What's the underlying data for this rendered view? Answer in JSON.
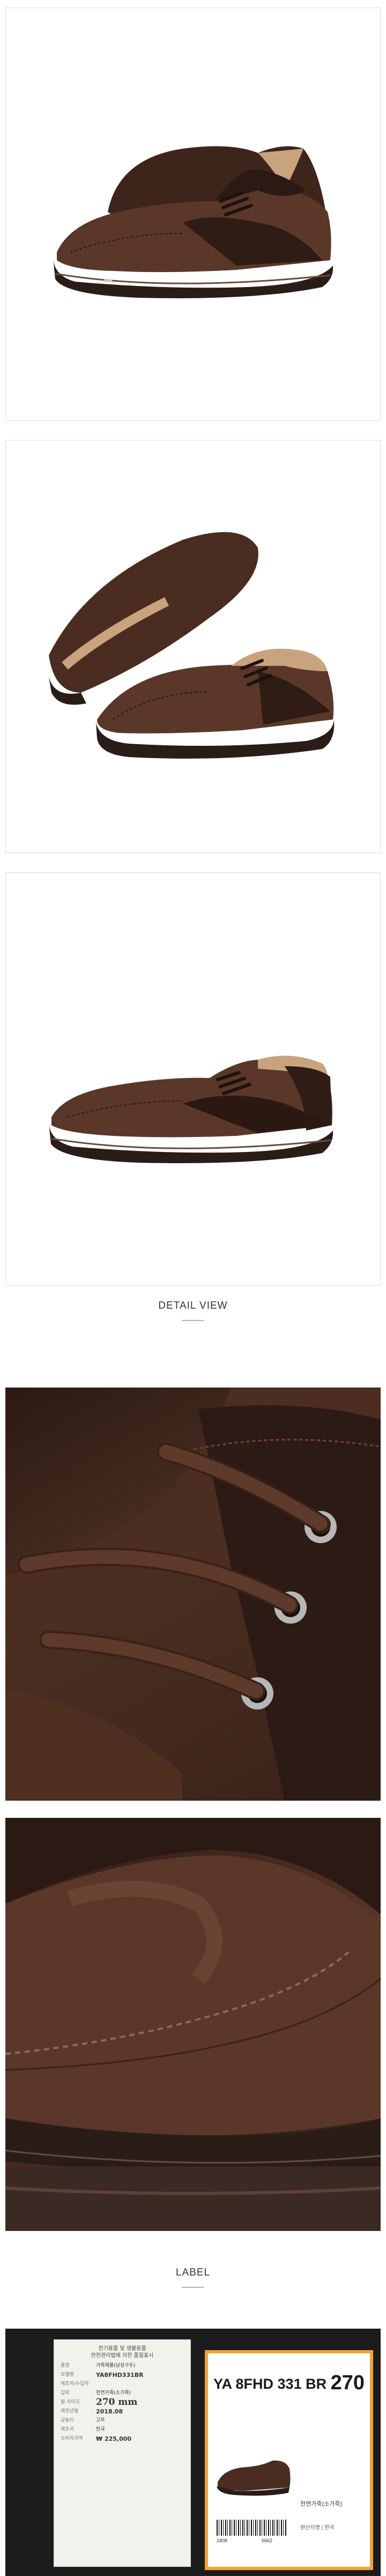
{
  "sections": {
    "detail_title": "DETAIL VIEW",
    "label_title": "LABEL"
  },
  "care_tag": {
    "header_line1": "전기용품 및 생활용품",
    "header_line2": "안전관리법에 의한 품질표시",
    "rows": [
      {
        "key": "품명",
        "value": "가죽제품(남성구두)"
      },
      {
        "key": "모델명",
        "value": "YA8FHD331BR"
      },
      {
        "key": "제조자/수입자",
        "value": ""
      },
      {
        "key": "갑피",
        "value": "천연가죽(소가죽)"
      },
      {
        "key": "발 사이즈",
        "value": "270 mm"
      },
      {
        "key": "제조년월",
        "value": "2018.08"
      },
      {
        "key": "굽높이",
        "value": "고무"
      },
      {
        "key": "제조국",
        "value": "한국"
      },
      {
        "key": "소비자가격",
        "value": "₩ 225,000"
      }
    ]
  },
  "size_label": {
    "code": "YA 8FHD 331 BR",
    "size": "270",
    "material": "천연가죽(소가죽)",
    "origin": "원산지명 | 한국",
    "barcode_left": "1808",
    "barcode_right": "6662"
  },
  "colors": {
    "leather_dark": "#3b2319",
    "leather_mid": "#5a3728",
    "sole": "#2a1d18",
    "label_border": "#f2a233"
  }
}
